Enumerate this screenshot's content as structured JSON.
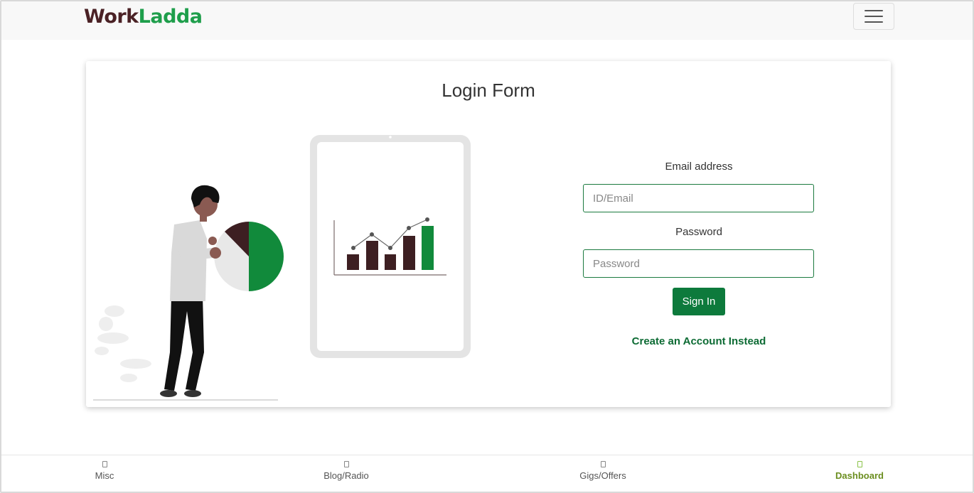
{
  "brand": {
    "part1": "Work",
    "part2": "Ladda"
  },
  "navbar": {
    "toggler_icon": "hamburger-menu-icon"
  },
  "card": {
    "title": "Login Form"
  },
  "form": {
    "email_label": "Email address",
    "email_placeholder": "ID/Email",
    "email_value": "",
    "password_label": "Password",
    "password_placeholder": "Password",
    "password_value": "",
    "signin_label": "Sign In",
    "create_account_link": "Create an Account Instead"
  },
  "bottom_nav": {
    "items": [
      {
        "label": "Misc",
        "icon": "misc-icon",
        "active": false
      },
      {
        "label": "Blog/Radio",
        "icon": "blog-radio-icon",
        "active": false
      },
      {
        "label": "Gigs/Offers",
        "icon": "gigs-offers-icon",
        "active": false
      },
      {
        "label": "Dashboard",
        "icon": "dashboard-icon",
        "active": true
      }
    ]
  },
  "colors": {
    "brand_dark": "#4a2125",
    "brand_green": "#1e9e4b",
    "button_green": "#0d7a3c",
    "active_nav": "#6b8e1f"
  }
}
